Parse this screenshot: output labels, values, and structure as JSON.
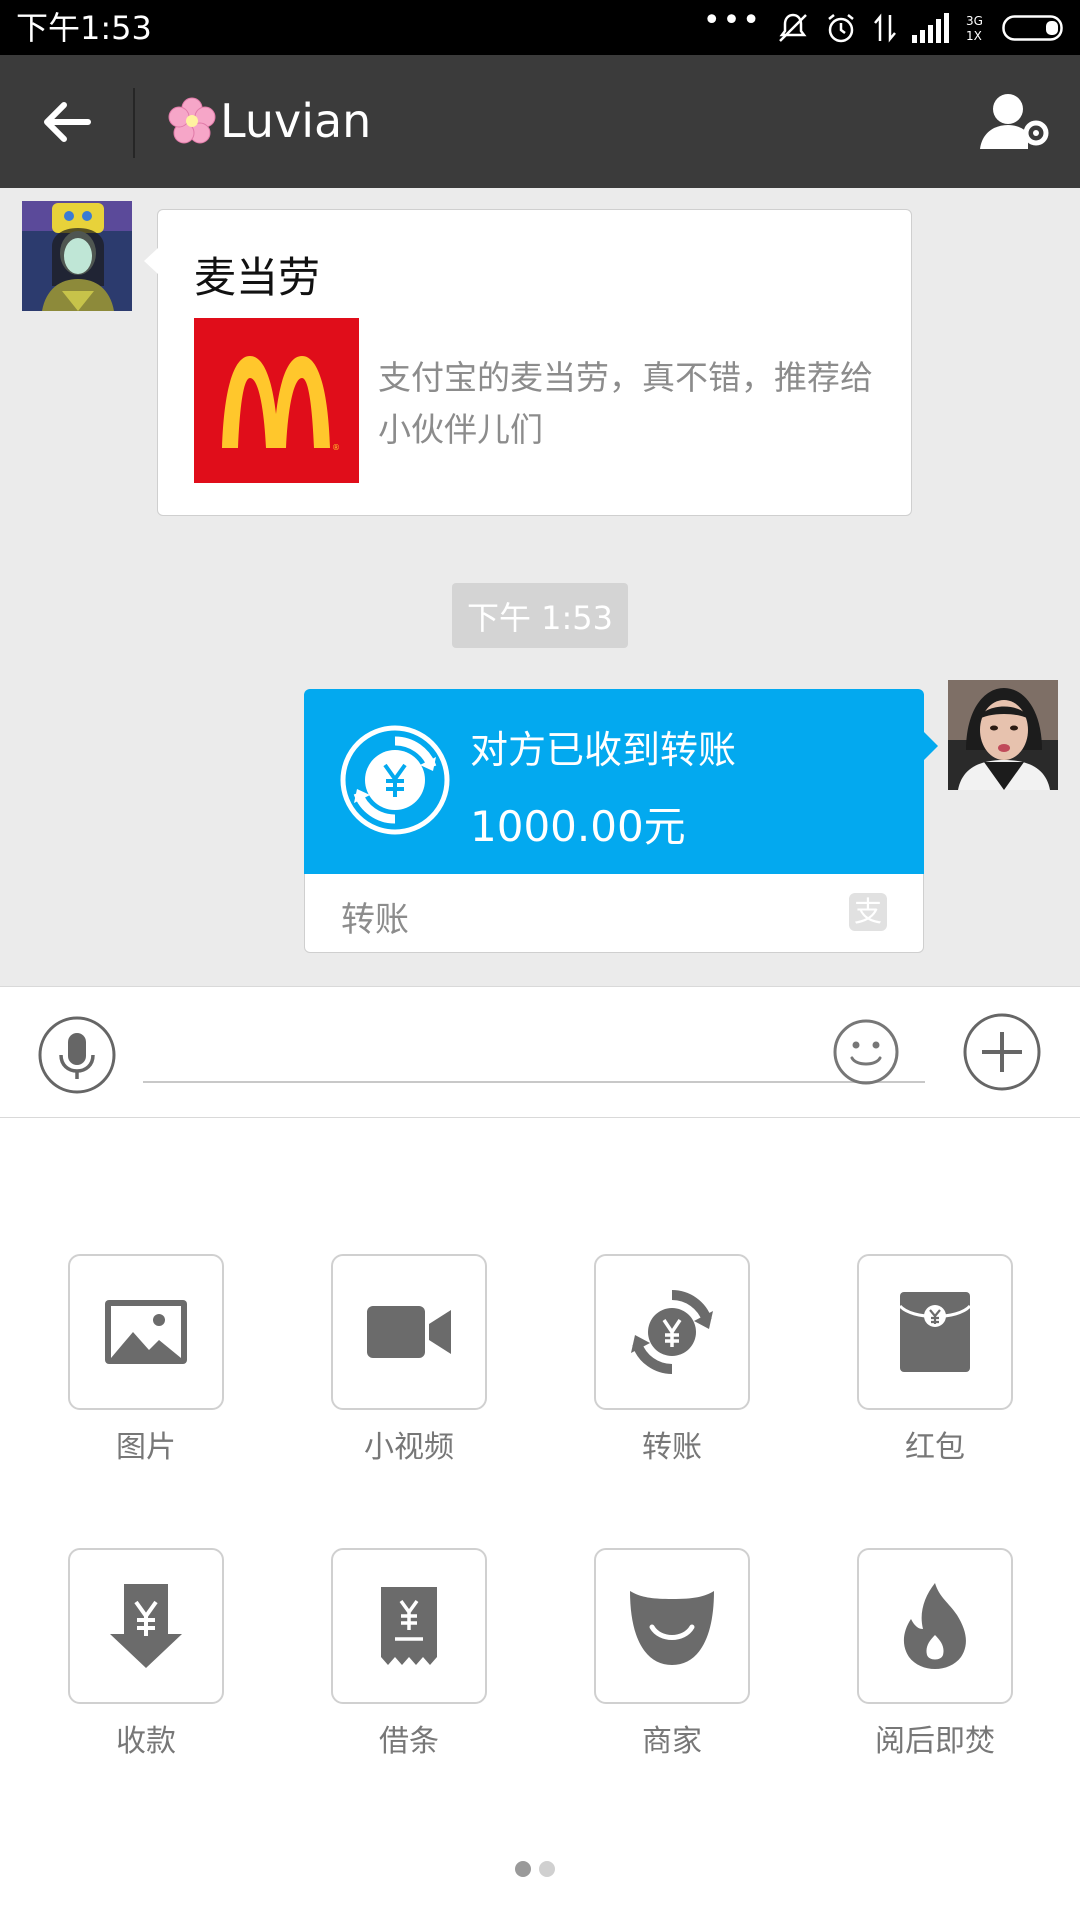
{
  "status_bar": {
    "time": "下午1:53",
    "network_label": "3G\n1X"
  },
  "header": {
    "title": "Luvian",
    "back_icon": "back-arrow-icon",
    "profile_icon": "contact-settings-icon"
  },
  "chat": {
    "messages": [
      {
        "type": "share",
        "side": "left",
        "title": "麦当劳",
        "description": "支付宝的麦当劳，真不错，推荐给小伙伴儿们",
        "thumbnail": "mcdonalds-logo"
      },
      {
        "type": "timestamp",
        "text": "下午 1:53"
      },
      {
        "type": "transfer",
        "side": "right",
        "status": "对方已收到转账",
        "amount": "1000.00元",
        "label": "转账",
        "accent_color": "#03a9ef"
      }
    ]
  },
  "input_bar": {
    "value": "",
    "placeholder": ""
  },
  "panel": {
    "tools": [
      {
        "label": "图片",
        "icon": "image-icon"
      },
      {
        "label": "小视频",
        "icon": "video-camera-icon"
      },
      {
        "label": "转账",
        "icon": "transfer-icon"
      },
      {
        "label": "红包",
        "icon": "red-envelope-icon"
      },
      {
        "label": "收款",
        "icon": "receive-money-icon"
      },
      {
        "label": "借条",
        "icon": "iou-icon"
      },
      {
        "label": "商家",
        "icon": "merchant-icon"
      },
      {
        "label": "阅后即焚",
        "icon": "burn-after-reading-icon"
      }
    ],
    "page_count": 2,
    "current_page": 1
  }
}
